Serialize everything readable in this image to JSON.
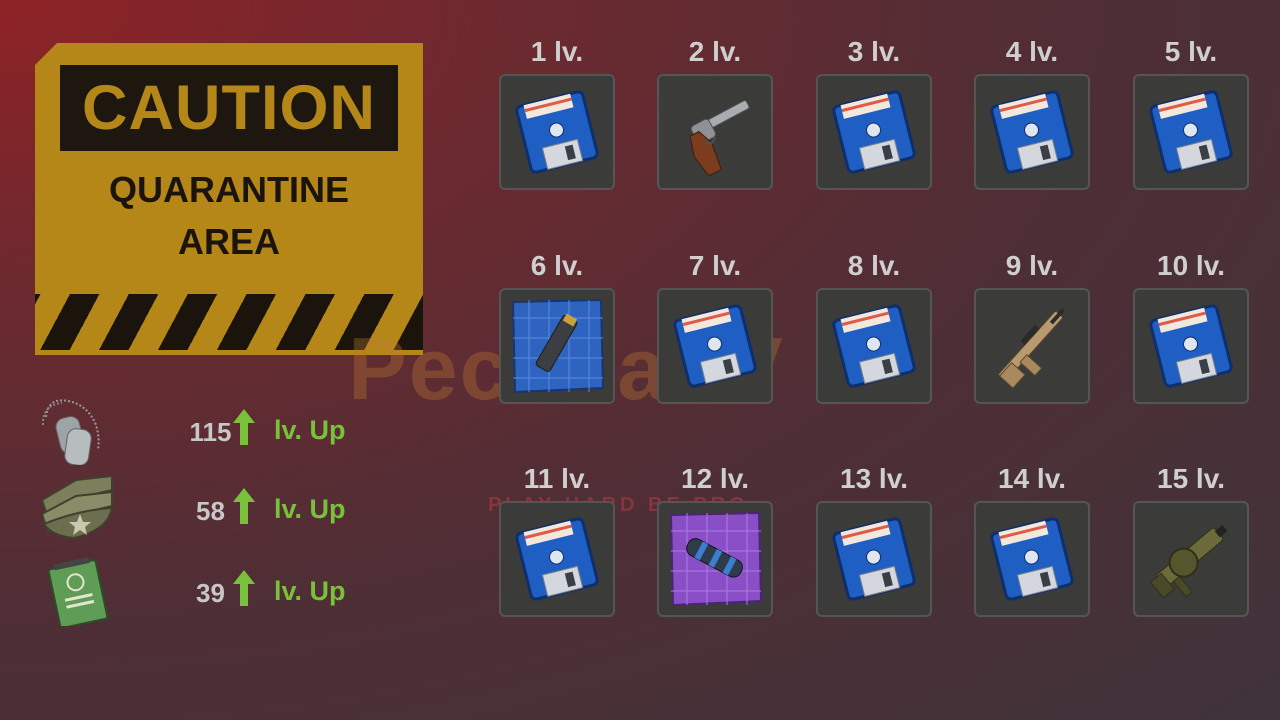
{
  "sign": {
    "title": "CAUTION",
    "line1": "QUARANTINE",
    "line2": "AREA"
  },
  "watermark": {
    "text": "PechkaTV",
    "tagline": "PLAY HARD BE PRO"
  },
  "stats": [
    {
      "icon": "dog-tags-icon",
      "value": "115",
      "label": "lv. Up"
    },
    {
      "icon": "sergeant-chevron-icon",
      "value": "58",
      "label": "lv. Up"
    },
    {
      "icon": "notebook-icon",
      "value": "39",
      "label": "lv. Up"
    }
  ],
  "rewards": [
    {
      "level": "1 lv.",
      "item": "floppy-disk-icon"
    },
    {
      "level": "2 lv.",
      "item": "revolver-icon"
    },
    {
      "level": "3 lv.",
      "item": "floppy-disk-icon"
    },
    {
      "level": "4 lv.",
      "item": "floppy-disk-icon"
    },
    {
      "level": "5 lv.",
      "item": "floppy-disk-icon"
    },
    {
      "level": "6 lv.",
      "item": "blueprint-magazine-icon"
    },
    {
      "level": "7 lv.",
      "item": "floppy-disk-icon"
    },
    {
      "level": "8 lv.",
      "item": "floppy-disk-icon"
    },
    {
      "level": "9 lv.",
      "item": "assault-rifle-icon"
    },
    {
      "level": "10 lv.",
      "item": "floppy-disk-icon"
    },
    {
      "level": "11 lv.",
      "item": "floppy-disk-icon"
    },
    {
      "level": "12 lv.",
      "item": "blueprint-suppressor-icon"
    },
    {
      "level": "13 lv.",
      "item": "floppy-disk-icon"
    },
    {
      "level": "14 lv.",
      "item": "floppy-disk-icon"
    },
    {
      "level": "15 lv.",
      "item": "grenade-launcher-icon"
    }
  ],
  "blueprint_caption": "icon: blueprint",
  "colors": {
    "caution_yellow": "#b58719",
    "level_up_green": "#79c13a",
    "slot_bg": "#3b3b39",
    "disk_blue": "#1f5fc4"
  }
}
